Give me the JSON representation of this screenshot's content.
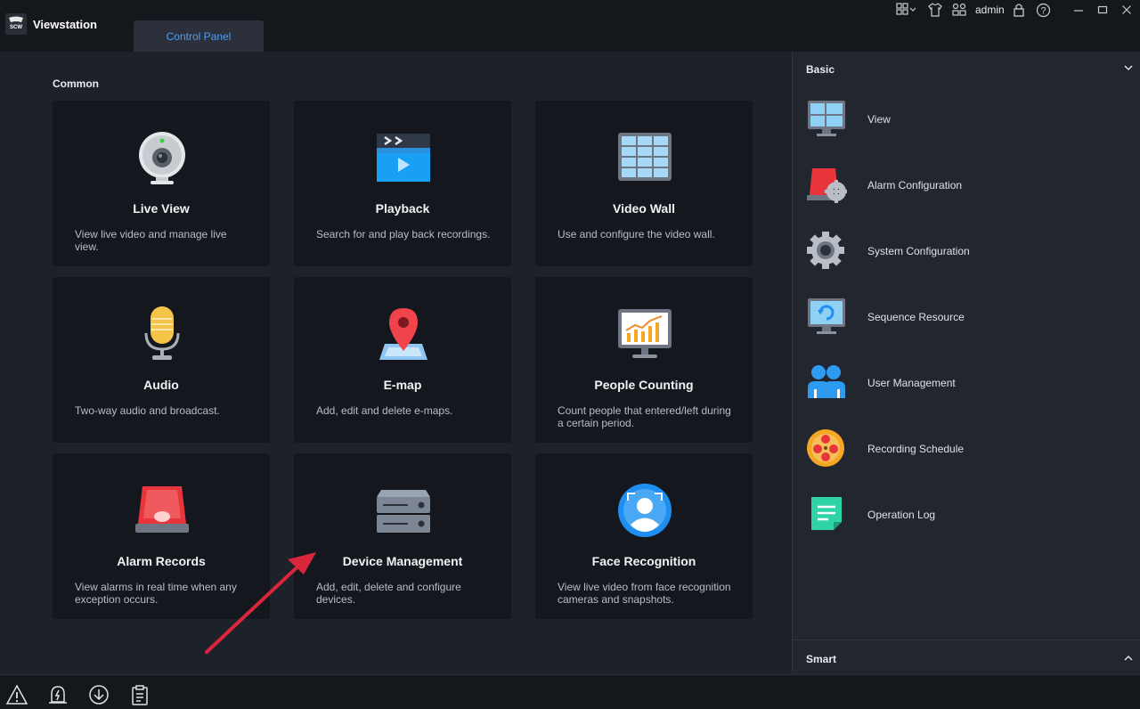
{
  "app": {
    "title": "Viewstation",
    "logo_text": "SCW"
  },
  "tabs": [
    {
      "label": "Control Panel"
    }
  ],
  "titlebar": {
    "user": "admin",
    "icons": [
      "layout-icon",
      "theme-shirt-icon",
      "users-network-icon",
      "lock-icon",
      "help-icon",
      "minimize-icon",
      "maximize-icon",
      "close-icon"
    ]
  },
  "main": {
    "section_title": "Common",
    "cards": [
      {
        "title": "Live View",
        "desc": "View live video and manage live view.",
        "icon": "webcam-icon"
      },
      {
        "title": "Playback",
        "desc": "Search for and play back recordings.",
        "icon": "playback-clapper-icon"
      },
      {
        "title": "Video Wall",
        "desc": "Use and configure the video wall.",
        "icon": "video-wall-icon"
      },
      {
        "title": "Audio",
        "desc": "Two-way audio and broadcast.",
        "icon": "microphone-icon"
      },
      {
        "title": "E-map",
        "desc": "Add, edit and delete e-maps.",
        "icon": "map-pin-icon"
      },
      {
        "title": "People Counting",
        "desc": "Count people that entered/left during a certain period.",
        "icon": "chart-monitor-icon"
      },
      {
        "title": "Alarm Records",
        "desc": "View alarms in real time when any exception occurs.",
        "icon": "alarm-siren-icon"
      },
      {
        "title": "Device Management",
        "desc": "Add, edit, delete and configure devices.",
        "icon": "server-device-icon"
      },
      {
        "title": "Face Recognition",
        "desc": "View live video from face recognition cameras and snapshots.",
        "icon": "face-recognition-icon"
      }
    ]
  },
  "side": {
    "basic_title": "Basic",
    "items": [
      {
        "label": "View",
        "icon": "view-monitor-icon"
      },
      {
        "label": "Alarm Configuration",
        "icon": "alarm-config-icon"
      },
      {
        "label": "System Configuration",
        "icon": "gear-icon"
      },
      {
        "label": "Sequence Resource",
        "icon": "sequence-monitor-icon"
      },
      {
        "label": "User Management",
        "icon": "user-management-icon"
      },
      {
        "label": "Recording Schedule",
        "icon": "recording-schedule-icon"
      },
      {
        "label": "Operation Log",
        "icon": "operation-log-icon"
      }
    ],
    "smart_title": "Smart"
  },
  "bottombar": {
    "icons": [
      "warning-icon",
      "alarm-bell-icon",
      "download-icon",
      "clipboard-icon"
    ]
  },
  "colors": {
    "accent": "#4a9ff5",
    "annotation_arrow": "#d9263b"
  }
}
